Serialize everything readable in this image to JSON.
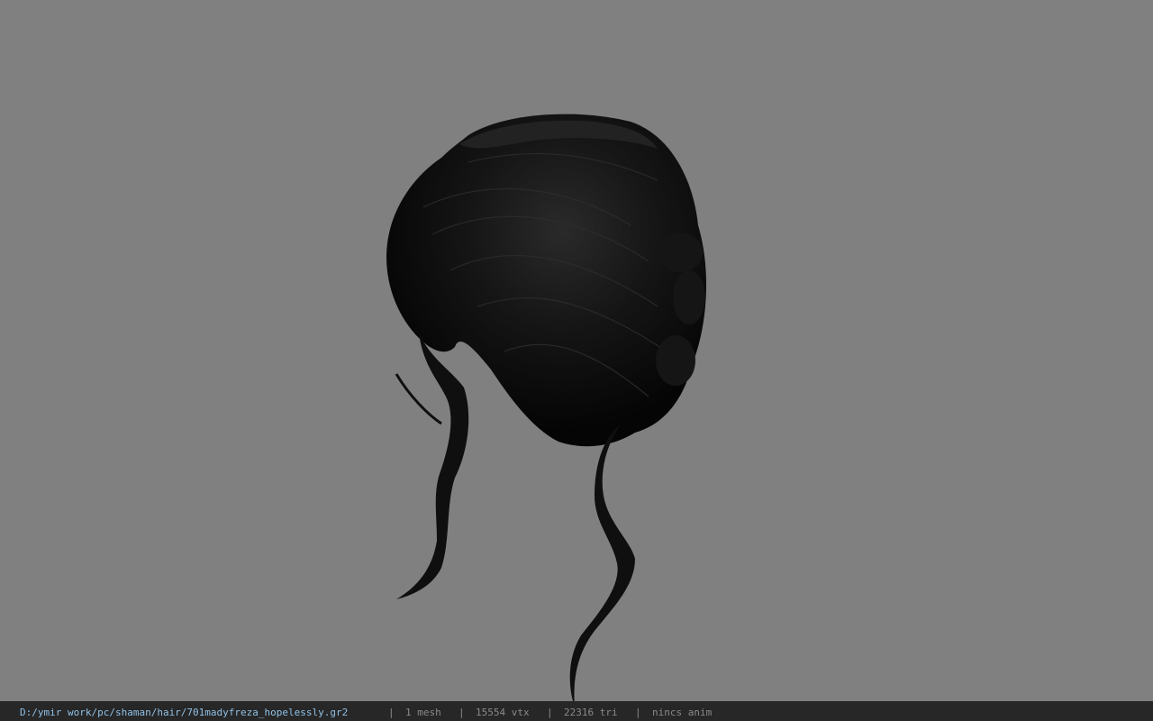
{
  "status_bar": {
    "file_path": "D:/ymir work/pc/shaman/hair/701madyfreza_hopelessly.gr2",
    "separator": "|",
    "mesh_count": "1 mesh",
    "vertex_count": "15554 vtx",
    "triangle_count": "22316 tri",
    "animation": "nincs anim"
  },
  "viewport": {
    "background_color": "#808080",
    "model_color": "#0c0c0c"
  }
}
